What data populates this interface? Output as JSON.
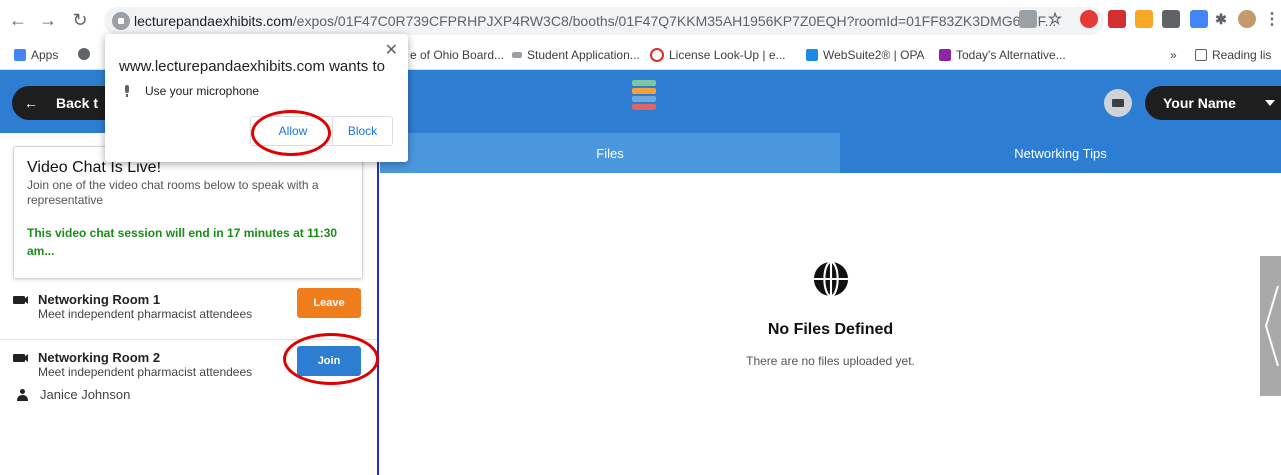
{
  "browser": {
    "url_domain": "lecturepandaexhibits.com",
    "url_path": "/expos/01F47C0R739CFPRHPJXP4RW3C8/booths/01F47Q7KKM35AH1956KP7Z0EQH?roomId=01FF83ZK3DMG65YF...",
    "bookmarks": [
      {
        "label": "Apps"
      },
      {
        "label": "e of Ohio Board..."
      },
      {
        "label": "Student Application..."
      },
      {
        "label": "License Look-Up | e..."
      },
      {
        "label": "WebSuite2® | OPA"
      },
      {
        "label": "Today's Alternative..."
      }
    ],
    "bookmark_overflow": "»",
    "reading_list": "Reading lis"
  },
  "permission_popup": {
    "title": "www.lecturepandaexhibits.com wants to",
    "close": "✕",
    "request": "Use your microphone",
    "allow_label": "Allow",
    "block_label": "Block"
  },
  "header": {
    "back_label": "Back t",
    "user_label": "Your Name"
  },
  "tabs": [
    {
      "label": "Files"
    },
    {
      "label": "Networking Tips"
    }
  ],
  "video_chat": {
    "title": "Video Chat Is Live!",
    "description": "Join one of the video chat rooms below to speak with a representative",
    "timer": "This video chat session will end in 17 minutes at 11:30 am..."
  },
  "rooms": [
    {
      "name": "Networking Room 1",
      "description": "Meet independent pharmacist attendees",
      "button": "Leave"
    },
    {
      "name": "Networking Room 2",
      "description": "Meet independent pharmacist attendees",
      "button": "Join",
      "attendee": "Janice Johnson"
    }
  ],
  "files": {
    "empty_title": "No Files Defined",
    "empty_desc": "There are no files uploaded yet."
  },
  "colors": {
    "header_blue": "#2d7dd2",
    "leave_orange": "#f07d1b",
    "annotation_red": "#e00000",
    "timer_green": "#1a8c1a"
  }
}
